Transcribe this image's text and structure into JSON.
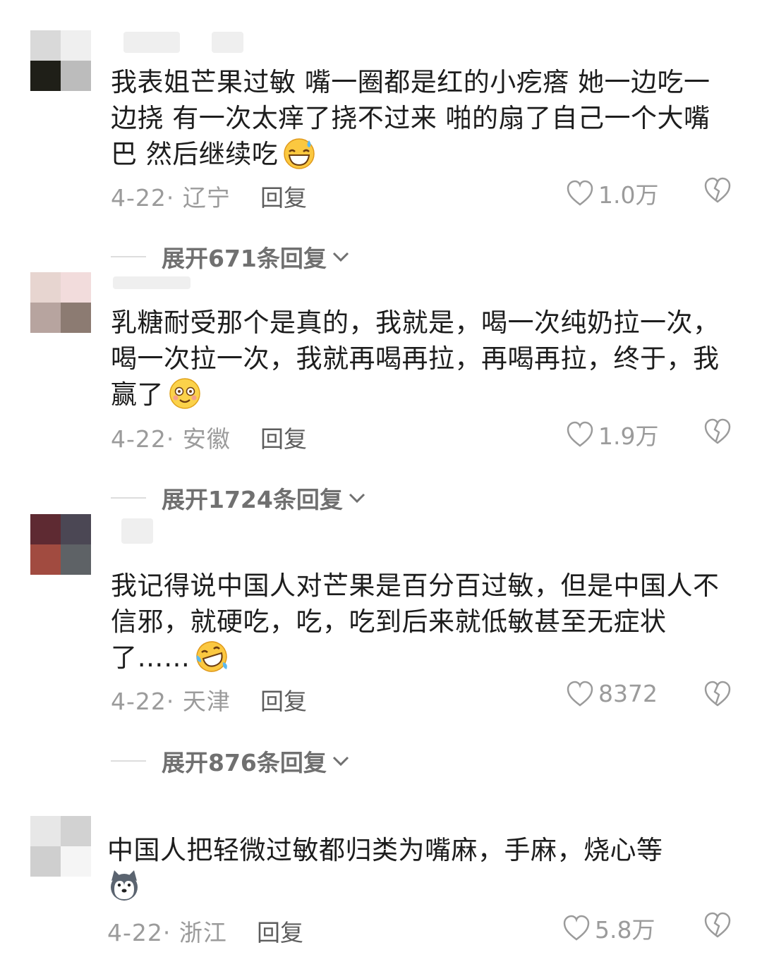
{
  "comments": [
    {
      "text": "我表姐芒果过敏 嘴一圈都是红的小疙瘩 她一边吃一边挠 有一次太痒了挠不过来 啪的扇了自己一个大嘴巴 然后继续吃",
      "emoji": "grinning-sweat-emoji",
      "date_region": "4-22· 辽宁",
      "reply": "回复",
      "likes": "1.0万",
      "expand": "展开671条回复",
      "avatar_colors": [
        "#d9d9d9",
        "#efefef",
        "#1f1f18",
        "#bcbcbc"
      ]
    },
    {
      "text": "乳糖耐受那个是真的，我就是，喝一次纯奶拉一次，喝一次拉一次，我就再喝再拉，再喝再拉，终于，我赢了",
      "emoji": "smiling-eyes-emoji",
      "date_region": "4-22· 安徽",
      "reply": "回复",
      "likes": "1.9万",
      "expand": "展开1724条回复",
      "avatar_colors": [
        "#e7d5d0",
        "#f2dcdc",
        "#b7a49f",
        "#8c7b72"
      ]
    },
    {
      "text": "我记得说中国人对芒果是百分百过敏，但是中国人不信邪，就硬吃，吃，吃到后来就低敏甚至无症状了……",
      "emoji": "tears-of-joy-emoji",
      "date_region": "4-22· 天津",
      "reply": "回复",
      "likes": "8372",
      "expand": "展开876条回复",
      "avatar_colors": [
        "#5e2a32",
        "#4b4754",
        "#a14b40",
        "#5e6266"
      ]
    },
    {
      "text": "中国人把轻微过敏都归类为嘴麻，手麻，烧心等",
      "emoji": "husky-emoji",
      "date_region": "4-22· 浙江",
      "reply": "回复",
      "likes": "5.8万",
      "avatar_colors": [
        "#e7e7e7",
        "#d2d2d2",
        "#cfcfcf",
        "#f5f5f5"
      ]
    }
  ],
  "colors": {
    "text": "#1d1d1d",
    "meta": "#9b9b9b",
    "reply": "#5d5d5d",
    "expand": "#707070"
  }
}
